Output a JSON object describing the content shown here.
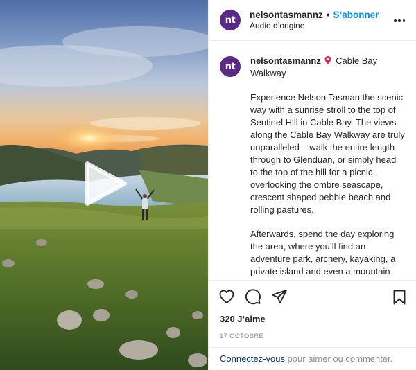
{
  "header": {
    "username": "nelsontasmannz",
    "separator": "•",
    "follow_label": "S’abonner",
    "audio_label": "Audio d’origine",
    "avatar_text": "nt"
  },
  "caption": {
    "username": "nelsontasmannz",
    "location_icon": "pin-icon",
    "location": "Cable Bay Walkway",
    "paragraph1": "Experience Nelson Tasman the scenic way with a sunrise stroll to the top of Sentinel Hill in Cable Bay. The views along the Cable Bay Walkway are truly unparalleled – walk the entire length through to Glenduan, or simply head to the top of the hill for a picnic, overlooking the ombre seascape, crescent shaped pebble beach and rolling pastures.",
    "paragraph2": "Afterwards, spend the day exploring the area, where you’ll find an adventure park, archery, kayaking, a private island and even a mountain-top retreat."
  },
  "actions": {
    "like_icon": "heart-icon",
    "comment_icon": "comment-icon",
    "share_icon": "share-icon",
    "save_icon": "bookmark-icon"
  },
  "likes_label": "320 J’aime",
  "date_label": "17 OCTOBRE",
  "login": {
    "link_label": "Connectez-vous",
    "rest_label": "pour aimer ou commenter."
  },
  "media": {
    "play_icon": "play-icon"
  },
  "colors": {
    "brand_avatar": "#5b2a86",
    "follow_blue": "#0095f6",
    "link_dark_blue": "#00376b",
    "muted_gray": "#8e8e8e"
  }
}
